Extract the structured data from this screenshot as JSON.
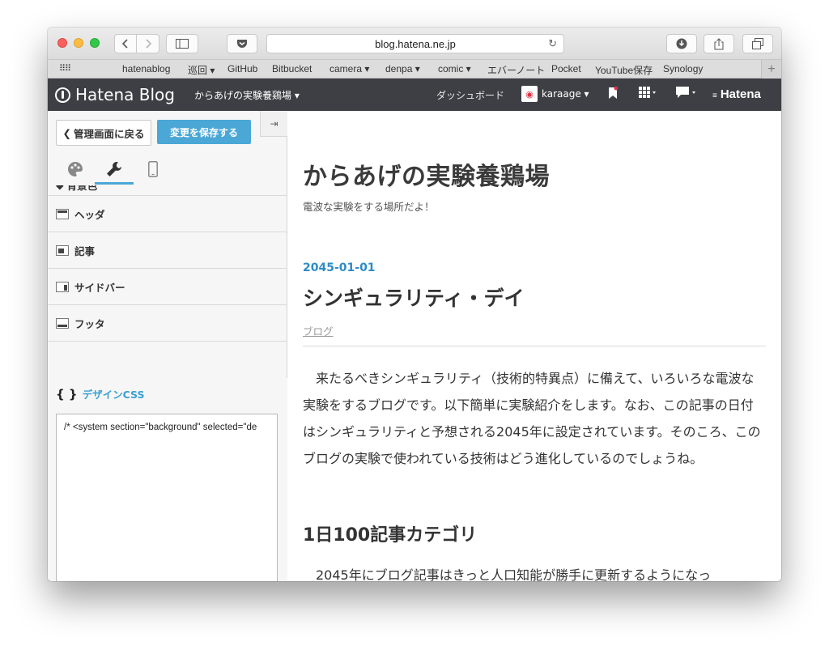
{
  "browser": {
    "url": "blog.hatena.ne.jp",
    "bookmarks": [
      "hatenablog",
      "巡回 ▾",
      "GitHub",
      "Bitbucket",
      "camera ▾",
      "denpa ▾",
      "comic ▾",
      "エバーノート",
      "Pocket",
      "YouTube保存",
      "Synology"
    ],
    "bookmarks_plus": "+"
  },
  "hatena_header": {
    "logo": "Hatena Blog",
    "blog_name": "からあげの実験養鶏場 ▾",
    "dashboard": "ダッシュボード",
    "user": "karaage ▾",
    "brand": "Hatena"
  },
  "panel": {
    "back_label": "管理画面に戻る",
    "save_label": "変更を保存する",
    "sections": {
      "background": "背景色",
      "header": "ヘッダ",
      "entry": "記事",
      "sidebar": "サイドバー",
      "footer": "フッタ"
    },
    "css": {
      "braces": "{ }",
      "label": "デザインCSS",
      "content": "/* <system section=\"background\" selected=\"de"
    }
  },
  "blog": {
    "title": "からあげの実験養鶏場",
    "description": "電波な実験をする場所だよ！",
    "entry": {
      "date": "2045-01-01",
      "title": "シンギュラリティ・デイ",
      "category": "ブログ",
      "body": "来たるべきシンギュラリティ（技術的特異点）に備えて、いろいろな電波な実験をするブログです。以下簡単に実験紹介をします。なお、この記事の日付はシンギュラリティと予想される2045年に設定されています。そのころ、このブログの実験で使われている技術はどう進化しているのでしょうね。",
      "heading": "1日100記事カテゴリ",
      "body2": "2045年にブログ記事はきっと人口知能が勝手に更新するようになっ"
    }
  },
  "colors": {
    "accent": "#4aa7d6",
    "header_bg": "#3d3f44",
    "date": "#2d8bc6"
  }
}
